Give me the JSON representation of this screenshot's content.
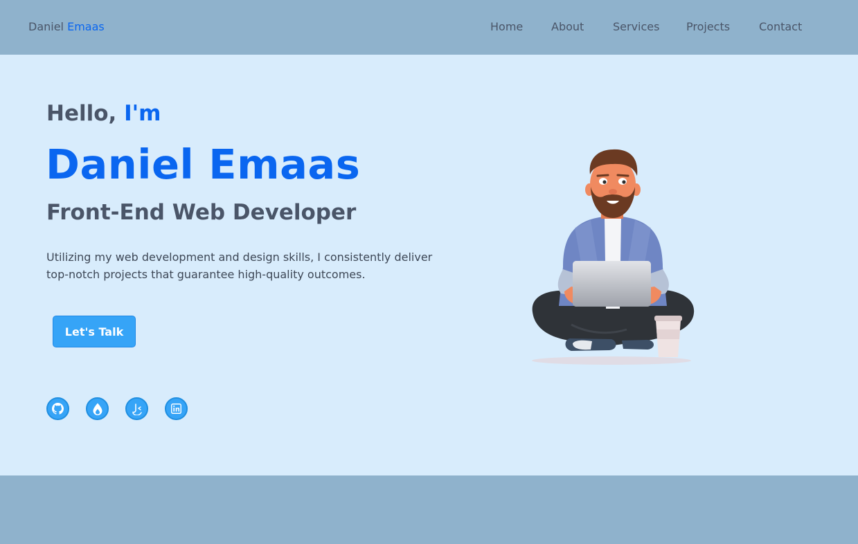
{
  "brand": {
    "first": "Daniel",
    "last": "Emaas"
  },
  "nav": {
    "items": [
      {
        "label": "Home"
      },
      {
        "label": "About"
      },
      {
        "label": "Services"
      },
      {
        "label": "Projects"
      },
      {
        "label": "Contact"
      }
    ]
  },
  "hero": {
    "greeting_prefix": "Hello,",
    "greeting_accent": "I'm",
    "name": "Daniel Emaas",
    "role": "Front-End Web Developer",
    "description": "Utilizing my web development and design skills, I consistently deliver top-notch projects that guarantee high-quality outcomes.",
    "cta_label": "Let's Talk",
    "illustration": "developer-with-laptop-illustration"
  },
  "social": [
    {
      "icon": "github-icon"
    },
    {
      "icon": "codepen-drop-icon"
    },
    {
      "icon": "codewars-icon"
    },
    {
      "icon": "linkedin-icon"
    }
  ],
  "colors": {
    "accent": "#0a66f0",
    "button": "#36a4f7",
    "hero_bg": "#d8ecfc",
    "band_bg": "#8fb2cc",
    "text": "#4a5568"
  }
}
